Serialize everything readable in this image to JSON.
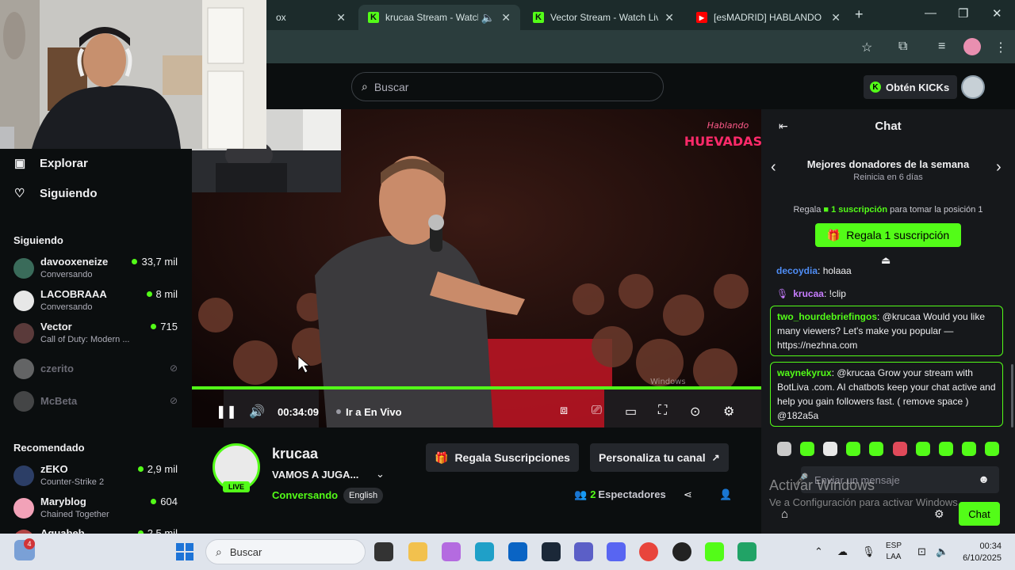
{
  "browser": {
    "tabs": [
      {
        "title": "ox",
        "favicon": "kick-icon",
        "color": "#53fc18",
        "active": false
      },
      {
        "title": "krucaa Stream - Watch L",
        "favicon": "kick-icon",
        "color": "#53fc18",
        "active": true
      },
      {
        "title": "Vector Stream - Watch Live",
        "favicon": "kick-icon",
        "color": "#53fc18",
        "active": false
      },
      {
        "title": "[esMADRID] HABLANDO HU",
        "favicon": "youtube-icon",
        "color": "#ff0000",
        "active": false
      }
    ],
    "close_glyph": "✕",
    "new_tab_glyph": "+"
  },
  "kick": {
    "search_placeholder": "Buscar",
    "get_kicks_label": "Obtén KICKs",
    "brand_color": "#53fc18"
  },
  "sidebar": {
    "nav": [
      {
        "label": "Explorar",
        "icon": "browse-icon"
      },
      {
        "label": "Siguiendo",
        "icon": "heart-icon"
      }
    ],
    "following_header": "Siguiendo",
    "following": [
      {
        "name": "davooxeneize",
        "sub": "Conversando",
        "viewers": "33,7 mil",
        "live": true
      },
      {
        "name": "LACOBRAAA",
        "sub": "Conversando",
        "viewers": "8 mil",
        "live": true
      },
      {
        "name": "Vector",
        "sub": "Call of Duty: Modern ...",
        "viewers": "715",
        "live": true
      },
      {
        "name": "czerito",
        "live": false
      },
      {
        "name": "McBeta",
        "live": false
      }
    ],
    "recommended_header": "Recomendado",
    "recommended": [
      {
        "name": "zEKO",
        "sub": "Counter-Strike 2",
        "viewers": "2,9 mil"
      },
      {
        "name": "Maryblog",
        "sub": "Chained Together",
        "viewers": "604"
      },
      {
        "name": "Aguabeb",
        "sub": "",
        "viewers": "2,5 mil"
      }
    ]
  },
  "player": {
    "time": "00:34:09",
    "go_live_label": "Ir a En Vivo",
    "overlay_logo": "Hablando HUEVADAS",
    "watermark": "Windows"
  },
  "channel": {
    "name": "krucaa",
    "title": "VAMOS A JUGA...",
    "category": "Conversando",
    "language": "English",
    "live_badge": "LIVE",
    "gift_subs_label": "Regala Suscripciones",
    "customize_label": "Personaliza tu canal",
    "viewers_count": "2",
    "viewers_label": "Espectadores"
  },
  "chat": {
    "title": "Chat",
    "donors_title": "Mejores donadores de la semana",
    "donors_sub": "Reinicia en 6 días",
    "gift_prefix": "Regala",
    "gift_highlight": "1 suscripción",
    "gift_suffix": "para tomar la posición 1",
    "gift_button": "Regala 1 suscripción",
    "messages": [
      {
        "user": "decoydia",
        "text": ": holaaa",
        "color": "#4f8ef7",
        "boxed": false
      },
      {
        "user": "krucaa",
        "text": ": !clip",
        "color": "#c77dff",
        "boxed": false
      },
      {
        "user": "two_hourdebriefingos",
        "text": ": @krucaa Would you like many viewers? Let's make you popular — https://nezhna.com",
        "color": "#53fc18",
        "boxed": true
      },
      {
        "user": "waynekyrux",
        "text": ": @krucaa Grow your stream with BotLiva .com. AI chatbots keep your chat active and help you gain followers fast. ( remove space ) @182a5a",
        "color": "#53fc18",
        "boxed": true
      }
    ],
    "input_placeholder": "Enviar un mensaje",
    "send_label": "Chat"
  },
  "windows": {
    "activate_title": "Activar Windows",
    "activate_sub": "Ve a Configuración para activar Windows.",
    "taskbar_search": "Buscar",
    "widget_badge": "4",
    "lang_line1": "ESP",
    "lang_line2": "LAA",
    "clock_time": "00:34",
    "clock_date": "6/10/2025"
  }
}
